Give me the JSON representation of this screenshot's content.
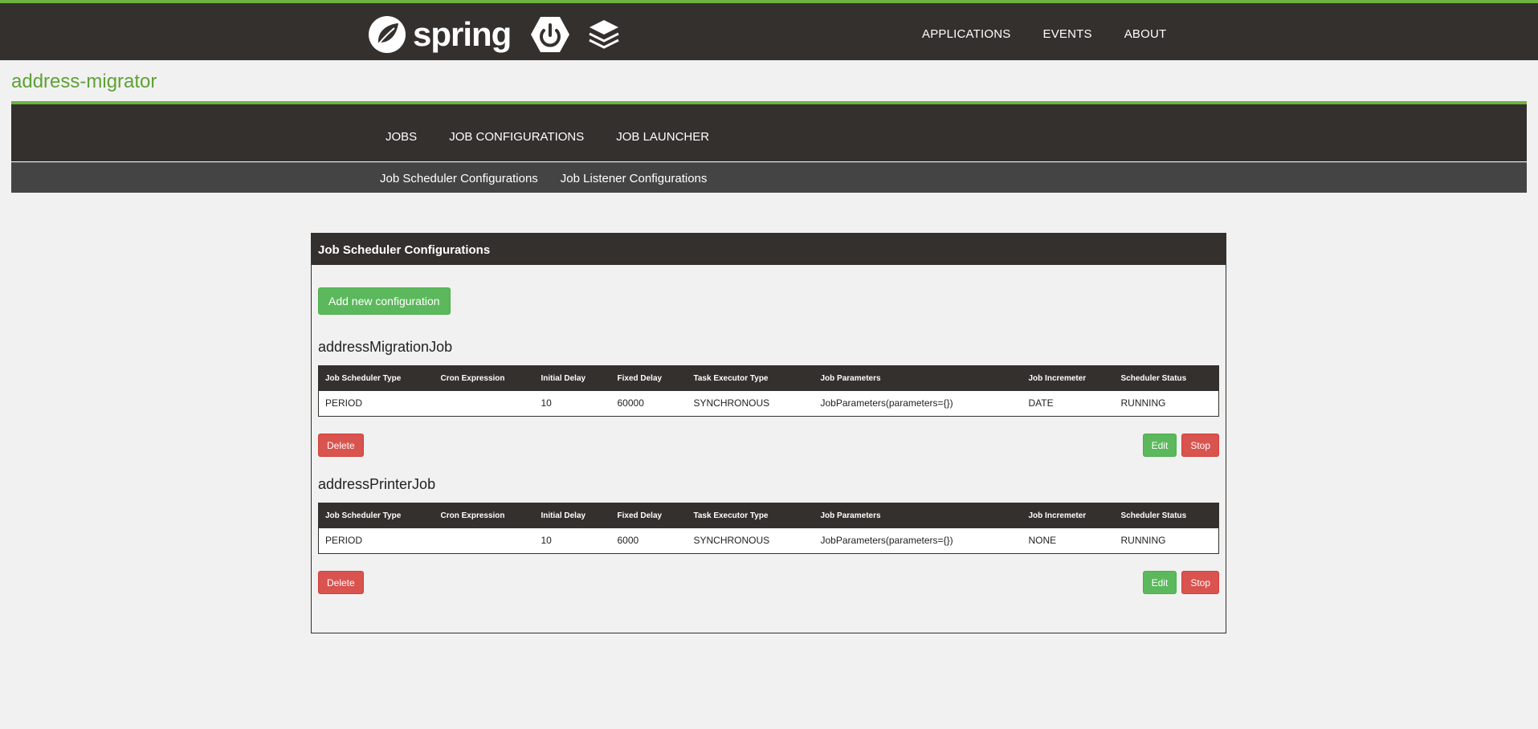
{
  "header": {
    "logo_word": "spring",
    "nav": [
      "APPLICATIONS",
      "EVENTS",
      "ABOUT"
    ],
    "brand_color": "#6db33f",
    "bar_color": "#34302d"
  },
  "app": {
    "title": "address-migrator"
  },
  "sub_nav": [
    "JOBS",
    "JOB CONFIGURATIONS",
    "JOB LAUNCHER"
  ],
  "tabs": [
    "Job Scheduler Configurations",
    "Job Listener Configurations"
  ],
  "panel": {
    "title": "Job Scheduler Configurations",
    "add_button": "Add new configuration",
    "columns": [
      "Job Scheduler Type",
      "Cron Expression",
      "Initial Delay",
      "Fixed Delay",
      "Task Executor Type",
      "Job Parameters",
      "Job Incremeter",
      "Scheduler Status"
    ],
    "jobs": [
      {
        "name": "addressMigrationJob",
        "row": [
          "PERIOD",
          "",
          "10",
          "60000",
          "SYNCHRONOUS",
          "JobParameters(parameters={})",
          "DATE",
          "RUNNING"
        ],
        "delete": "Delete",
        "edit": "Edit",
        "stop": "Stop"
      },
      {
        "name": "addressPrinterJob",
        "row": [
          "PERIOD",
          "",
          "10",
          "6000",
          "SYNCHRONOUS",
          "JobParameters(parameters={})",
          "NONE",
          "RUNNING"
        ],
        "delete": "Delete",
        "edit": "Edit",
        "stop": "Stop"
      }
    ]
  }
}
